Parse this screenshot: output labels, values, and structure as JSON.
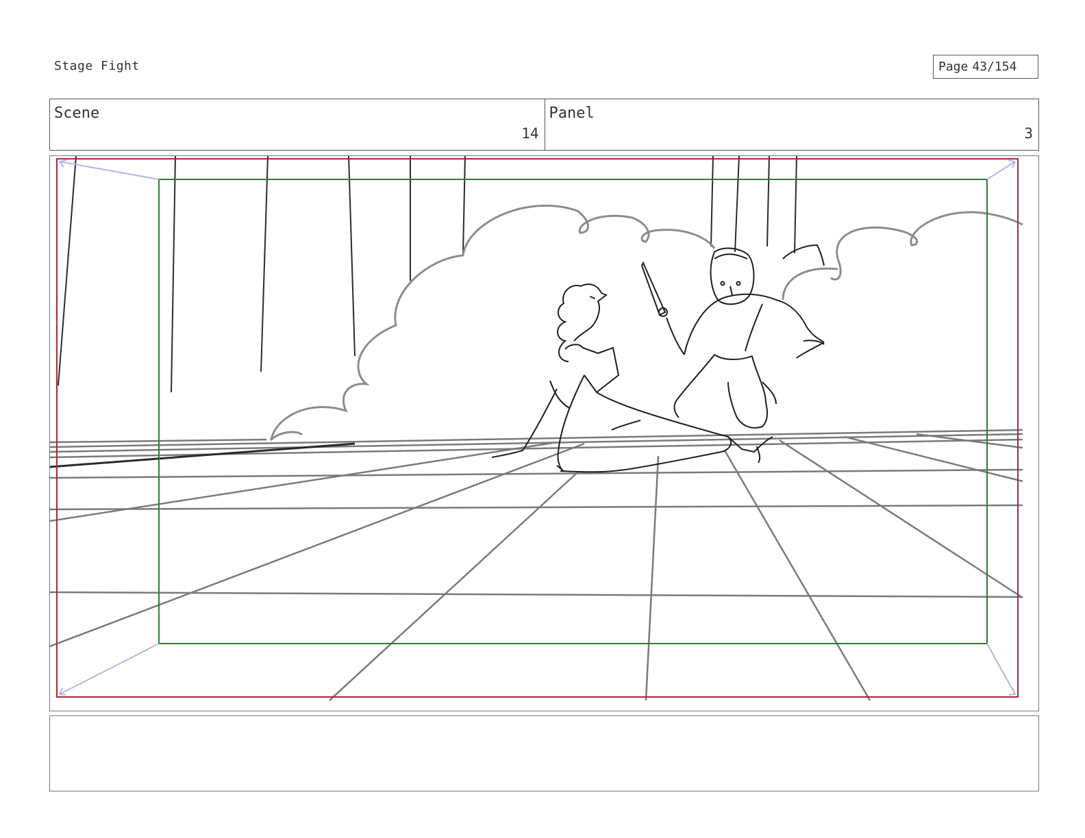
{
  "header": {
    "project_title": "Stage Fight",
    "page_label": "Page",
    "page_number": "43/154"
  },
  "scene": {
    "label": "Scene",
    "value": "14"
  },
  "panel": {
    "label": "Panel",
    "value": "3"
  },
  "frame": {
    "safe_area_color": "#a8283a",
    "action_safe_color": "#2e7d32",
    "guide_arrow_color": "#b9b3e6",
    "sketch_color": "#1e1e1e",
    "grid_color": "#7a7a7a"
  },
  "notes": {
    "text": ""
  }
}
